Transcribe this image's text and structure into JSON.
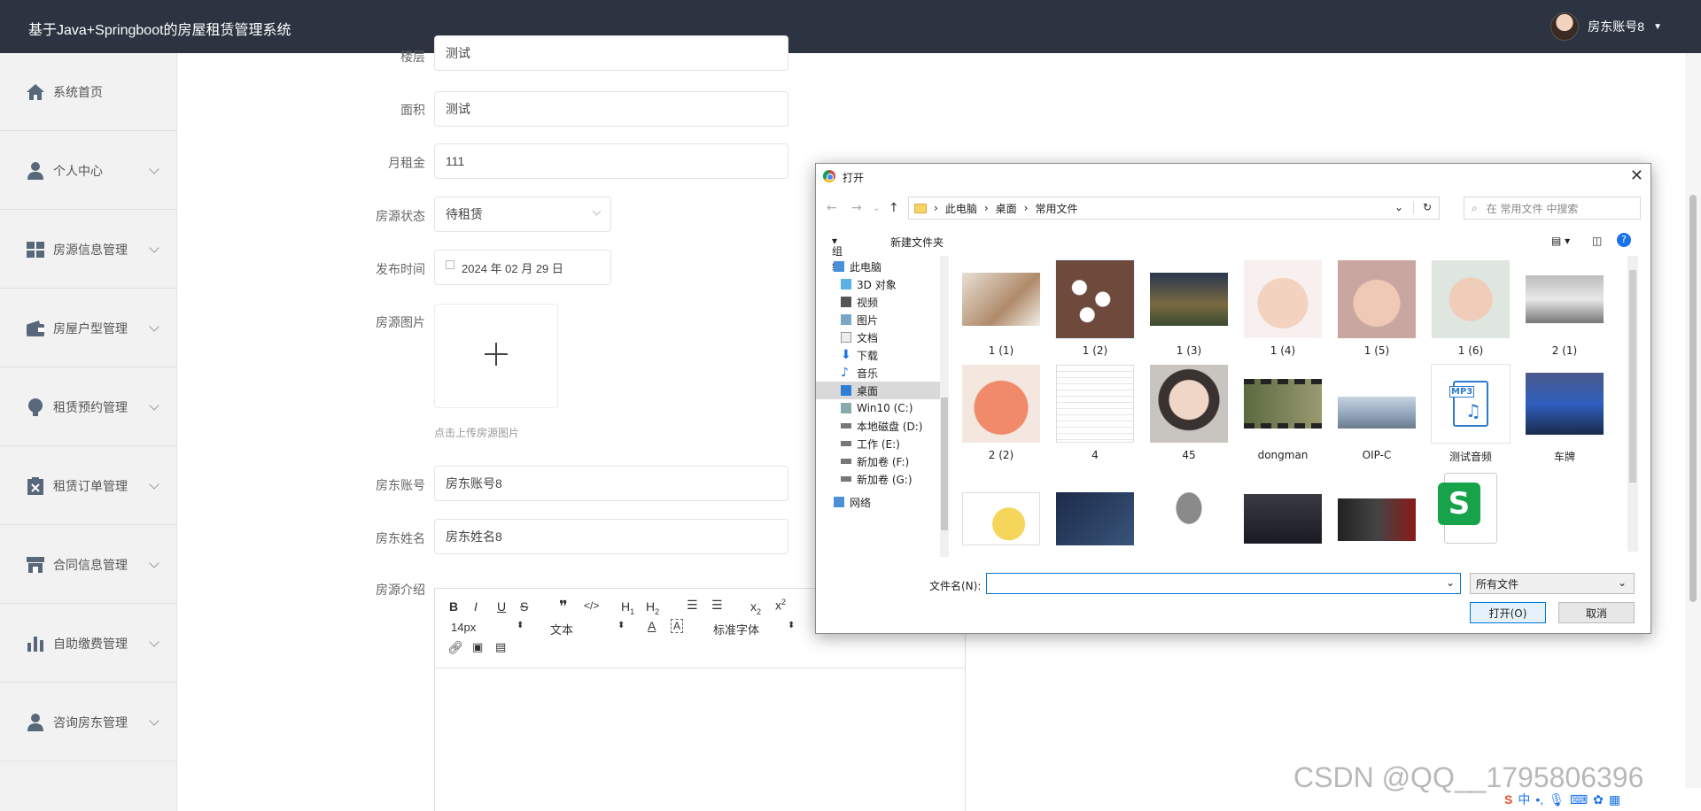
{
  "header": {
    "title": "基于Java+Springboot的房屋租赁管理系统",
    "user_label": "房东账号8"
  },
  "sidebar": {
    "items": [
      {
        "label": "系统首页"
      },
      {
        "label": "个人中心"
      },
      {
        "label": "房源信息管理"
      },
      {
        "label": "房屋户型管理"
      },
      {
        "label": "租赁预约管理"
      },
      {
        "label": "租赁订单管理"
      },
      {
        "label": "合同信息管理"
      },
      {
        "label": "自助缴费管理"
      },
      {
        "label": "咨询房东管理"
      }
    ]
  },
  "form": {
    "floor_label": "楼层",
    "floor_value": "测试",
    "area_label": "面积",
    "area_value": "测试",
    "rent_label": "月租金",
    "rent_value": "111",
    "status_label": "房源状态",
    "status_value": "待租赁",
    "date_label": "发布时间",
    "date_value": "2024 年 02 月 29 日",
    "image_label": "房源图片",
    "image_hint": "点击上传房源图片",
    "account_label": "房东账号",
    "account_value": "房东账号8",
    "name_label": "房东姓名",
    "name_value": "房东姓名8",
    "intro_label": "房源介绍"
  },
  "editor": {
    "font_size": "14px",
    "block_type": "文本",
    "font_family": "标准字体"
  },
  "dialog": {
    "title": "打开",
    "path": [
      "此电脑",
      "桌面",
      "常用文件"
    ],
    "search_placeholder": "在 常用文件 中搜索",
    "organize": "组织",
    "new_folder": "新建文件夹",
    "tree": [
      "此电脑",
      "3D 对象",
      "视频",
      "图片",
      "文档",
      "下载",
      "音乐",
      "桌面",
      "Win10 (C:)",
      "本地磁盘 (D:)",
      "工作 (E:)",
      "新加卷 (F:)",
      "新加卷 (G:)",
      "网络"
    ],
    "files": [
      "1 (1)",
      "1 (2)",
      "1 (3)",
      "1 (4)",
      "1 (5)",
      "1 (6)",
      "2 (1)",
      "2 (2)",
      "4",
      "45",
      "dongman",
      "OIP-C",
      "测试音频",
      "车牌"
    ],
    "filename_label": "文件名(N):",
    "filetype": "所有文件",
    "open_button": "打开(O)",
    "cancel_button": "取消",
    "mp3_badge": "MP3"
  },
  "watermark": "CSDN @QQ__1795806396",
  "tray": "中"
}
